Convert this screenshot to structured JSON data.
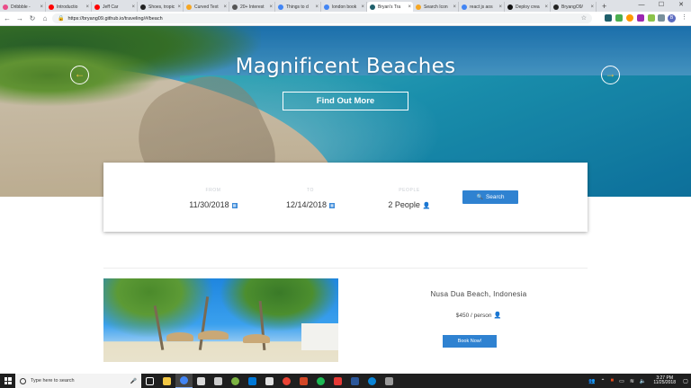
{
  "browser": {
    "tabs": [
      {
        "title": "Dribbble - ",
        "color": "#ea4c89"
      },
      {
        "title": "Introductio",
        "color": "#ff0000"
      },
      {
        "title": "Jeff Car",
        "color": "#ff0000"
      },
      {
        "title": "Shoes, tropic",
        "color": "#222222"
      },
      {
        "title": "Curved Text",
        "color": "#f5a623"
      },
      {
        "title": "20+ Interest",
        "color": "#555555"
      },
      {
        "title": "Things to d",
        "color": "#4285f4"
      },
      {
        "title": "london book",
        "color": "#4285f4"
      },
      {
        "title": "Bryan's Tra",
        "color": "#1f5f6b"
      },
      {
        "title": "Search Icon",
        "color": "#f5a623"
      },
      {
        "title": "react js aos",
        "color": "#4285f4"
      },
      {
        "title": "Deploy crea",
        "color": "#111111"
      },
      {
        "title": "BryangO9/",
        "color": "#222222"
      }
    ],
    "active_tab_index": 8,
    "new_tab": "+",
    "window_controls": {
      "minimize": "—",
      "maximize": "☐",
      "close": "✕"
    },
    "url": "https://bryang09.github.io/traveling/#/beach",
    "profile_initial": "B"
  },
  "hero": {
    "title": "Magnificent Beaches",
    "button_label": "Find Out More",
    "prev_arrow": "←",
    "next_arrow": "→"
  },
  "search": {
    "from_label": "FROM",
    "from_value": "11/30/2018",
    "to_label": "TO",
    "to_value": "12/14/2018",
    "people_label": "PEOPLE",
    "people_value": "2 People",
    "button_label": "Search"
  },
  "listing": {
    "name": "Nusa Dua Beach, Indonesia",
    "price": "$450 / person",
    "book_label": "Book Now!"
  },
  "taskbar": {
    "search_placeholder": "Type here to search",
    "time": "3:27 PM",
    "date": "11/25/2018"
  }
}
